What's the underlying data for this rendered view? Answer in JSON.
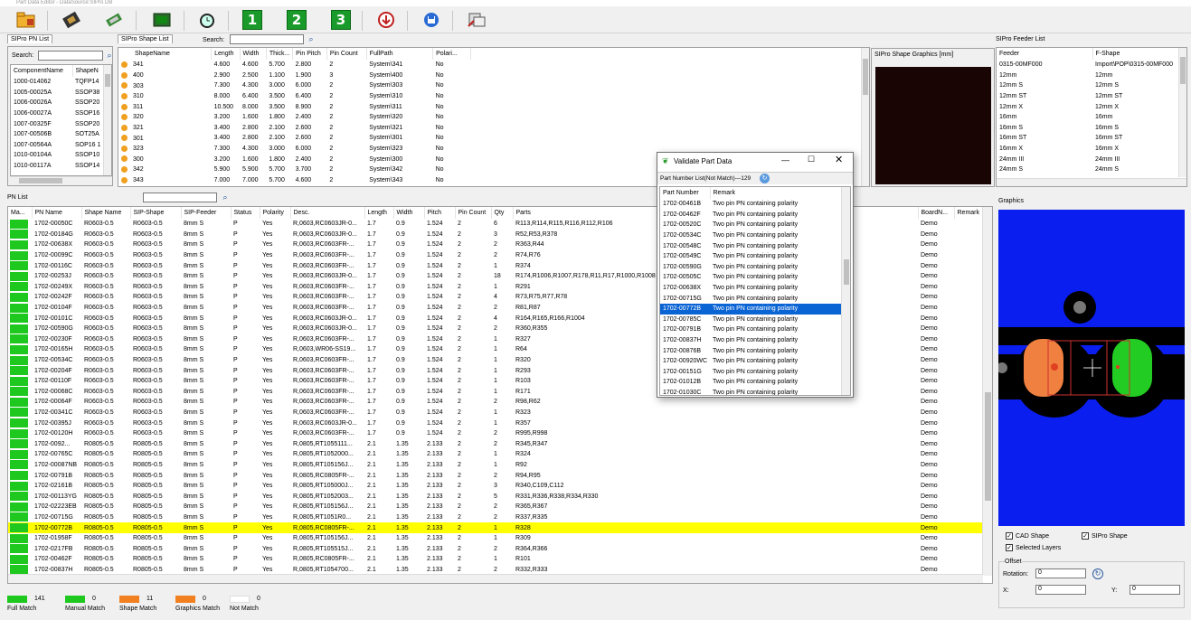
{
  "window": {
    "title": "Part Data Editor - DataSource:SIPro DB"
  },
  "toolbar": {
    "buttons": [
      "1",
      "2",
      "3"
    ]
  },
  "pnlist_panel": {
    "tab": "SIPro PN List",
    "search_label": "Search:",
    "search_value": "",
    "columns": [
      "ComponentName",
      "ShapeN"
    ],
    "rows": [
      [
        "1000-014062",
        "TQFP14"
      ],
      [
        "1005-00025A",
        "SSOP38"
      ],
      [
        "1006-00026A",
        "SSOP20"
      ],
      [
        "1006-00027A",
        "SSOP16"
      ],
      [
        "1007-00325F",
        "SSOP20"
      ],
      [
        "1007-00506B",
        "SOT25A"
      ],
      [
        "1007-00564A",
        "SOP16 1"
      ],
      [
        "1010-00104A",
        "SSOP10"
      ],
      [
        "1010-00117A",
        "SSOP14"
      ]
    ]
  },
  "shape_panel": {
    "tab": "SIPro Shape List",
    "search_label": "Search:",
    "columns": [
      "ShapeName",
      "Length",
      "Width",
      "Thick...",
      "Pin Pitch",
      "Pin Count",
      "FullPath",
      "Polari..."
    ],
    "rows": [
      [
        "341",
        "4.600",
        "4.600",
        "5.700",
        "2.800",
        "2",
        "System\\341",
        "No"
      ],
      [
        "400",
        "2.900",
        "2.500",
        "1.100",
        "1.900",
        "3",
        "System\\400",
        "No"
      ],
      [
        "303",
        "7.300",
        "4.300",
        "3.000",
        "6.000",
        "2",
        "System\\303",
        "No"
      ],
      [
        "310",
        "8.000",
        "6.400",
        "3.500",
        "6.400",
        "2",
        "System\\310",
        "No"
      ],
      [
        "311",
        "10.500",
        "8.000",
        "3.500",
        "8.900",
        "2",
        "System\\311",
        "No"
      ],
      [
        "320",
        "3.200",
        "1.600",
        "1.800",
        "2.400",
        "2",
        "System\\320",
        "No"
      ],
      [
        "321",
        "3.400",
        "2.800",
        "2.100",
        "2.600",
        "2",
        "System\\321",
        "No"
      ],
      [
        "301",
        "3.400",
        "2.800",
        "2.100",
        "2.600",
        "2",
        "System\\301",
        "No"
      ],
      [
        "323",
        "7.300",
        "4.300",
        "3.000",
        "6.000",
        "2",
        "System\\323",
        "No"
      ],
      [
        "300",
        "3.200",
        "1.600",
        "1.800",
        "2.400",
        "2",
        "System\\300",
        "No"
      ],
      [
        "342",
        "5.900",
        "5.900",
        "5.700",
        "3.700",
        "2",
        "System\\342",
        "No"
      ],
      [
        "343",
        "7.000",
        "7.000",
        "5.700",
        "4.600",
        "2",
        "System\\343",
        "No"
      ]
    ]
  },
  "shape_graphics": {
    "label": "SIPro Shape Graphics  [mm]"
  },
  "feeder_panel": {
    "tab": "SIPro Feeder List",
    "columns": [
      "Feeder",
      "F-Shape"
    ],
    "rows": [
      [
        "0315-00MF000",
        "Import\\POP\\0315-00MF000"
      ],
      [
        "12mm",
        "12mm"
      ],
      [
        "12mm S",
        "12mm S"
      ],
      [
        "12mm ST",
        "12mm ST"
      ],
      [
        "12mm X",
        "12mm X"
      ],
      [
        "16mm",
        "16mm"
      ],
      [
        "16mm S",
        "16mm S"
      ],
      [
        "16mm ST",
        "16mm ST"
      ],
      [
        "16mm X",
        "16mm X"
      ],
      [
        "24mm III",
        "24mm III"
      ],
      [
        "24mm S",
        "24mm S"
      ]
    ]
  },
  "pn_list": {
    "label": "PN List",
    "columns": [
      "Ma...",
      "PN Name",
      "Shape Name",
      "SIP-Shape",
      "SIP-Feeder",
      "Status",
      "Polarity",
      "Desc.",
      "Length",
      "Width",
      "Pitch",
      "Pin Count",
      "Qty",
      "Parts",
      "BoardN...",
      "Remark"
    ],
    "rows": [
      [
        "1702-00050C",
        "R0603-0.5",
        "R0603-0.5",
        "8mm S",
        "P",
        "Yes",
        "R,0603,RC0603JR-0...",
        "1.7",
        "0.9",
        "1.524",
        "2",
        "6",
        "R113,R114,R115,R116,R112,R106",
        "Demo",
        ""
      ],
      [
        "1702-00184G",
        "R0603-0.5",
        "R0603-0.5",
        "8mm S",
        "P",
        "Yes",
        "R,0603,RC0603JR-0...",
        "1.7",
        "0.9",
        "1.524",
        "2",
        "3",
        "R52,R53,R378",
        "Demo",
        ""
      ],
      [
        "1702-00638X",
        "R0603-0.5",
        "R0603-0.5",
        "8mm S",
        "P",
        "Yes",
        "R,0603,RC0603FR-...",
        "1.7",
        "0.9",
        "1.524",
        "2",
        "2",
        "R363,R44",
        "Demo",
        ""
      ],
      [
        "1702-00099C",
        "R0603-0.5",
        "R0603-0.5",
        "8mm S",
        "P",
        "Yes",
        "R,0603,RC0603FR-...",
        "1.7",
        "0.9",
        "1.524",
        "2",
        "2",
        "R74,R76",
        "Demo",
        ""
      ],
      [
        "1702-00116C",
        "R0603-0.5",
        "R0603-0.5",
        "8mm S",
        "P",
        "Yes",
        "R,0603,RC0603FR-...",
        "1.7",
        "0.9",
        "1.524",
        "2",
        "1",
        "R374",
        "Demo",
        ""
      ],
      [
        "1702-00253J",
        "R0603-0.5",
        "R0603-0.5",
        "8mm S",
        "P",
        "Yes",
        "R,0603,RC0603JR-0...",
        "1.7",
        "0.9",
        "1.524",
        "2",
        "18",
        "R174,R1006,R1007,R178,R11,R17,R1000,R1008",
        "Demo",
        ""
      ],
      [
        "1702-00249X",
        "R0603-0.5",
        "R0603-0.5",
        "8mm S",
        "P",
        "Yes",
        "R,0603,RC0603FR-...",
        "1.7",
        "0.9",
        "1.524",
        "2",
        "1",
        "R291",
        "Demo",
        ""
      ],
      [
        "1702-00242F",
        "R0603-0.5",
        "R0603-0.5",
        "8mm S",
        "P",
        "Yes",
        "R,0603,RC0603FR-...",
        "1.7",
        "0.9",
        "1.524",
        "2",
        "4",
        "R73,R75,R77,R78",
        "Demo",
        ""
      ],
      [
        "1702-00104F",
        "R0603-0.5",
        "R0603-0.5",
        "8mm S",
        "P",
        "Yes",
        "R,0603,RC0603FR-...",
        "1.7",
        "0.9",
        "1.524",
        "2",
        "2",
        "R81,R87",
        "Demo",
        ""
      ],
      [
        "1702-00101C",
        "R0603-0.5",
        "R0603-0.5",
        "8mm S",
        "P",
        "Yes",
        "R,0603,RC0603JR-0...",
        "1.7",
        "0.9",
        "1.524",
        "2",
        "4",
        "R164,R165,R166,R1004",
        "Demo",
        ""
      ],
      [
        "1702-00590G",
        "R0603-0.5",
        "R0603-0.5",
        "8mm S",
        "P",
        "Yes",
        "R,0603,RC0603JR-0...",
        "1.7",
        "0.9",
        "1.524",
        "2",
        "2",
        "R360,R355",
        "Demo",
        ""
      ],
      [
        "1702-00230F",
        "R0603-0.5",
        "R0603-0.5",
        "8mm S",
        "P",
        "Yes",
        "R,0603,RC0603FR-...",
        "1.7",
        "0.9",
        "1.524",
        "2",
        "1",
        "R327",
        "Demo",
        ""
      ],
      [
        "1702-00165H",
        "R0603-0.5",
        "R0603-0.5",
        "8mm S",
        "P",
        "Yes",
        "R,0603,WR06-SS19...",
        "1.7",
        "0.9",
        "1.524",
        "2",
        "1",
        "R64",
        "Demo",
        ""
      ],
      [
        "1702-00534C",
        "R0603-0.5",
        "R0603-0.5",
        "8mm S",
        "P",
        "Yes",
        "R,0603,RC0603FR-...",
        "1.7",
        "0.9",
        "1.524",
        "2",
        "1",
        "R320",
        "Demo",
        ""
      ],
      [
        "1702-00204F",
        "R0603-0.5",
        "R0603-0.5",
        "8mm S",
        "P",
        "Yes",
        "R,0603,RC0603FR-...",
        "1.7",
        "0.9",
        "1.524",
        "2",
        "1",
        "R293",
        "Demo",
        ""
      ],
      [
        "1702-00110F",
        "R0603-0.5",
        "R0603-0.5",
        "8mm S",
        "P",
        "Yes",
        "R,0603,RC0603FR-...",
        "1.7",
        "0.9",
        "1.524",
        "2",
        "1",
        "R103",
        "Demo",
        ""
      ],
      [
        "1702-00068C",
        "R0603-0.5",
        "R0603-0.5",
        "8mm S",
        "P",
        "Yes",
        "R,0603,RC0603FR-...",
        "1.7",
        "0.9",
        "1.524",
        "2",
        "1",
        "R171",
        "Demo",
        ""
      ],
      [
        "1702-00064F",
        "R0603-0.5",
        "R0603-0.5",
        "8mm S",
        "P",
        "Yes",
        "R,0603,RC0603FR-...",
        "1.7",
        "0.9",
        "1.524",
        "2",
        "2",
        "R98,R62",
        "Demo",
        ""
      ],
      [
        "1702-00341C",
        "R0603-0.5",
        "R0603-0.5",
        "8mm S",
        "P",
        "Yes",
        "R,0603,RC0603FR-...",
        "1.7",
        "0.9",
        "1.524",
        "2",
        "1",
        "R323",
        "Demo",
        ""
      ],
      [
        "1702-00395J",
        "R0603-0.5",
        "R0603-0.5",
        "8mm S",
        "P",
        "Yes",
        "R,0603,RC0603JR-0...",
        "1.7",
        "0.9",
        "1.524",
        "2",
        "1",
        "R357",
        "Demo",
        ""
      ],
      [
        "1702-00120H",
        "R0603-0.5",
        "R0603-0.5",
        "8mm S",
        "P",
        "Yes",
        "R,0603,RC0603FR-...",
        "1.7",
        "0.9",
        "1.524",
        "2",
        "2",
        "R995,R998",
        "Demo",
        ""
      ],
      [
        "1702-0092...",
        "R0805-0.5",
        "R0805-0.5",
        "8mm S",
        "P",
        "Yes",
        "R,0805,RT1055111...",
        "2.1",
        "1.35",
        "2.133",
        "2",
        "2",
        "R345,R347",
        "Demo",
        ""
      ],
      [
        "1702-00765C",
        "R0805-0.5",
        "R0805-0.5",
        "8mm S",
        "P",
        "Yes",
        "R,0805,RT1052000...",
        "2.1",
        "1.35",
        "2.133",
        "2",
        "1",
        "R324",
        "Demo",
        ""
      ],
      [
        "1702-00087NB",
        "R0805-0.5",
        "R0805-0.5",
        "8mm S",
        "P",
        "Yes",
        "R,0805,RT105156J...",
        "2.1",
        "1.35",
        "2.133",
        "2",
        "1",
        "R92",
        "Demo",
        ""
      ],
      [
        "1702-00791B",
        "R0805-0.5",
        "R0805-0.5",
        "8mm S",
        "P",
        "Yes",
        "R,0805,RC0805FR-...",
        "2.1",
        "1.35",
        "2.133",
        "2",
        "2",
        "R94,R95",
        "Demo",
        ""
      ],
      [
        "1702-02161B",
        "R0805-0.5",
        "R0805-0.5",
        "8mm S",
        "P",
        "Yes",
        "R,0805,RT105000J...",
        "2.1",
        "1.35",
        "2.133",
        "2",
        "3",
        "R340,C109,C112",
        "Demo",
        ""
      ],
      [
        "1702-00113YG",
        "R0805-0.5",
        "R0805-0.5",
        "8mm S",
        "P",
        "Yes",
        "R,0805,RT1052003...",
        "2.1",
        "1.35",
        "2.133",
        "2",
        "5",
        "R331,R336,R338,R334,R330",
        "Demo",
        ""
      ],
      [
        "1702-02223EB",
        "R0805-0.5",
        "R0805-0.5",
        "8mm S",
        "P",
        "Yes",
        "R,0805,RT105156J...",
        "2.1",
        "1.35",
        "2.133",
        "2",
        "2",
        "R365,R367",
        "Demo",
        ""
      ],
      [
        "1702-00715G",
        "R0805-0.5",
        "R0805-0.5",
        "8mm S",
        "P",
        "Yes",
        "R,0805,RT1051R0...",
        "2.1",
        "1.35",
        "2.133",
        "2",
        "2",
        "R337,R335",
        "Demo",
        ""
      ],
      [
        "1702-00772B",
        "R0805-0.5",
        "R0805-0.5",
        "8mm S",
        "P",
        "Yes",
        "R,0805,RC0805FR-...",
        "2.1",
        "1.35",
        "2.133",
        "2",
        "1",
        "R328",
        "Demo",
        ""
      ],
      [
        "1702-01958F",
        "R0805-0.5",
        "R0805-0.5",
        "8mm S",
        "P",
        "Yes",
        "R,0805,RT105156J...",
        "2.1",
        "1.35",
        "2.133",
        "2",
        "1",
        "R309",
        "Demo",
        ""
      ],
      [
        "1702-0217FB",
        "R0805-0.5",
        "R0805-0.5",
        "8mm S",
        "P",
        "Yes",
        "R,0805,RT105515J...",
        "2.1",
        "1.35",
        "2.133",
        "2",
        "2",
        "R364,R366",
        "Demo",
        ""
      ],
      [
        "1702-00462F",
        "R0805-0.5",
        "R0805-0.5",
        "8mm S",
        "P",
        "Yes",
        "R,0805,RC0805FR-...",
        "2.1",
        "1.35",
        "2.133",
        "2",
        "1",
        "R101",
        "Demo",
        ""
      ],
      [
        "1702-00837H",
        "R0805-0.5",
        "R0805-0.5",
        "8mm S",
        "P",
        "Yes",
        "R,0805,RT1054700...",
        "2.1",
        "1.35",
        "2.133",
        "2",
        "2",
        "R332,R333",
        "Demo",
        ""
      ]
    ]
  },
  "legend": [
    {
      "count": "141",
      "label": "Full Match",
      "color": "#1ec81e"
    },
    {
      "count": "0",
      "label": "Manual Match",
      "color": "#1ec81e"
    },
    {
      "count": "11",
      "label": "Shape Match",
      "color": "#f08020"
    },
    {
      "count": "0",
      "label": "Graphics Match",
      "color": "#f08020"
    },
    {
      "count": "0",
      "label": "Not Match",
      "color": "#ffffff"
    }
  ],
  "graphics_panel": {
    "label": "Graphics",
    "cad_shape": "CAD Shape",
    "sipro_shape": "SIPro Shape",
    "selected_layers": "Selected Layers",
    "offset_label": "Offset",
    "rotation_label": "Rotation:",
    "rotation_value": "0",
    "x_label": "X:",
    "x_value": "0",
    "y_label": "Y:",
    "y_value": "0"
  },
  "dialog": {
    "title": "Validate Part Data",
    "list_label": "Part Number List(Not Match)---129",
    "columns": [
      "Part Number",
      "Remark"
    ],
    "rows": [
      [
        "1702-00461B",
        "Two pin PN containing polarity"
      ],
      [
        "1702-00462F",
        "Two pin PN containing polarity"
      ],
      [
        "1702-00520C",
        "Two pin PN containing polarity"
      ],
      [
        "1702-00534C",
        "Two pin PN containing polarity"
      ],
      [
        "1702-00548C",
        "Two pin PN containing polarity"
      ],
      [
        "1702-00549C",
        "Two pin PN containing polarity"
      ],
      [
        "1702-00590G",
        "Two pin PN containing polarity"
      ],
      [
        "1702-00505C",
        "Two pin PN containing polarity"
      ],
      [
        "1702-00638X",
        "Two pin PN containing polarity"
      ],
      [
        "1702-00715G",
        "Two pin PN containing polarity"
      ],
      [
        "1702-00772B",
        "Two pin PN containing polarity"
      ],
      [
        "1702-00785C",
        "Two pin PN containing polarity"
      ],
      [
        "1702-00791B",
        "Two pin PN containing polarity"
      ],
      [
        "1702-00837H",
        "Two pin PN containing polarity"
      ],
      [
        "1702-00876B",
        "Two pin PN containing polarity"
      ],
      [
        "1702-00920WC",
        "Two pin PN containing polarity"
      ],
      [
        "1702-00151G",
        "Two pin PN containing polarity"
      ],
      [
        "1702-01012B",
        "Two pin PN containing polarity"
      ],
      [
        "1702-01030C",
        "Two pin PN containing polarity"
      ]
    ],
    "selected_index": 10,
    "colors": {
      "accent": "#0a64d4"
    }
  },
  "colors": {
    "highlight": "#ffff00",
    "board_blue": "#0a1ef0",
    "pad_orange": "#f08040",
    "pad_green": "#22cc22"
  }
}
